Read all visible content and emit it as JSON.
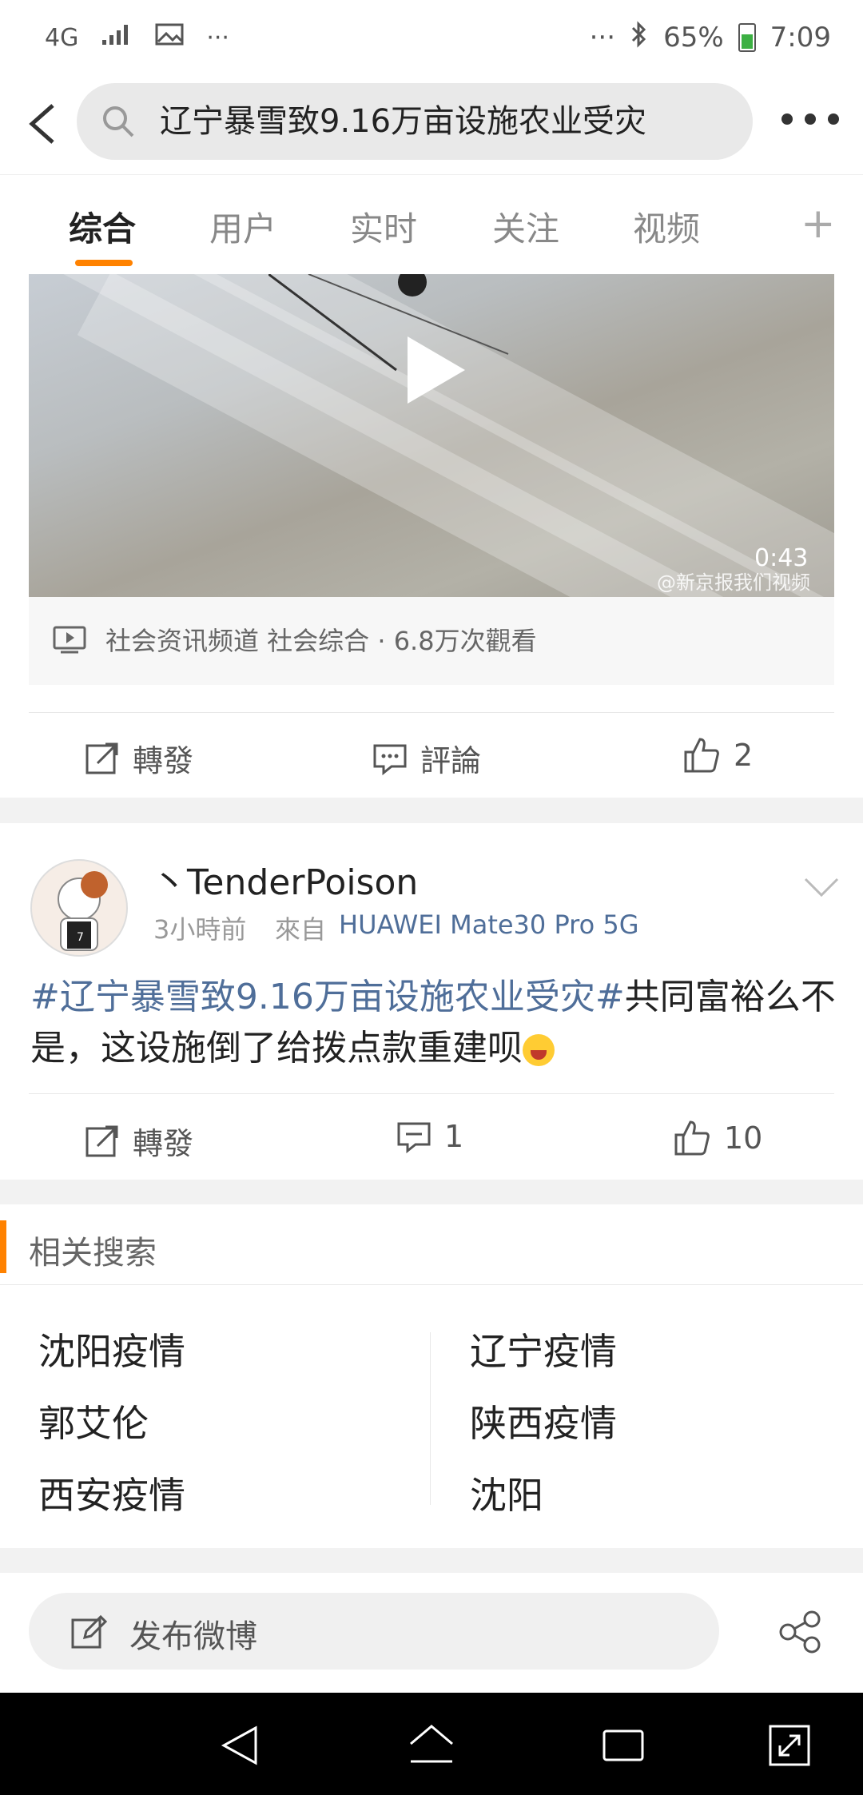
{
  "status_bar": {
    "network": "4G",
    "signal": "..ıl",
    "dots_left": "···",
    "dots_right": "···",
    "battery": "65%",
    "time": "7:09"
  },
  "header": {
    "search_query": "辽宁暴雪致9.16万亩设施农业受灾"
  },
  "tabs": [
    "综合",
    "用户",
    "实时",
    "关注",
    "视频"
  ],
  "video_card": {
    "duration": "0:43",
    "watermark": "@新京报我们视频",
    "meta": "社会资讯频道 社会综合 · 6.8万次觀看",
    "repost_label": "轉發",
    "comment_label": "評論",
    "like_count": "2"
  },
  "post": {
    "username": "丶TenderPoison",
    "time": "3小時前",
    "source_prefix": "來自",
    "device": "HUAWEI Mate30 Pro 5G",
    "hashtag": "#辽宁暴雪致9.16万亩设施农业受灾#",
    "body": "共同富裕么不是，这设施倒了给拨点款重建呗",
    "repost_label": "轉發",
    "comment_count": "1",
    "like_count": "10"
  },
  "related": {
    "title": "相关搜索",
    "left": [
      "沈阳疫情",
      "郭艾伦",
      "西安疫情"
    ],
    "right": [
      "辽宁疫情",
      "陕西疫情",
      "沈阳"
    ]
  },
  "compose": {
    "label": "发布微博"
  },
  "colors": {
    "accent": "#ff8200",
    "link": "#4f6e99"
  }
}
